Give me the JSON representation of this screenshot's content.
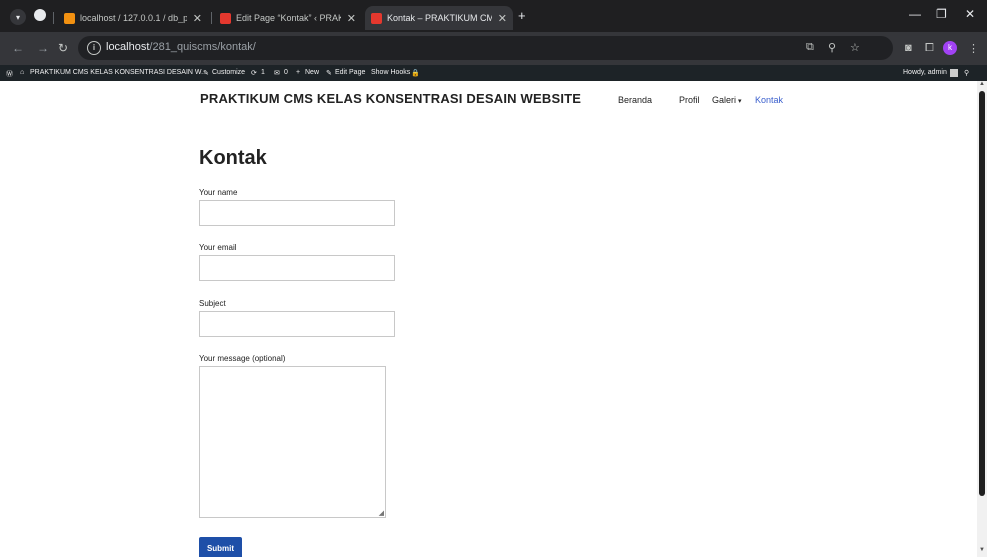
{
  "browser": {
    "tabs": [
      {
        "title": "localhost / 127.0.0.1 / db_prakti",
        "active": false,
        "favicon_color": "#f29111"
      },
      {
        "title": "Edit Page “Kontak” ‹ PRAKTIKUI",
        "active": false,
        "favicon_color": "#e5382e"
      },
      {
        "title": "Kontak – PRAKTIKUM CMS KEL",
        "active": true,
        "favicon_color": "#e5382e"
      }
    ],
    "new_tab": "+",
    "url_host": "localhost",
    "url_path": "/281_quiscms/kontak/",
    "profile_initial": "k"
  },
  "admin_bar": {
    "site_name": "PRAKTIKUM CMS KELAS KONSENTRASI DESAIN W...",
    "customize": "Customize",
    "updates_count": "1",
    "comments_count": "0",
    "new": "New",
    "edit_page": "Edit Page",
    "show_hooks": "Show Hooks",
    "howdy": "Howdy, admin"
  },
  "site": {
    "title": "PRAKTIKUM CMS KELAS KONSENTRASI DESAIN WEBSITE",
    "menu": [
      "Beranda",
      "Profil",
      "Galeri",
      "Kontak"
    ],
    "current_menu": "Kontak",
    "accent": "#3a5fcd"
  },
  "page": {
    "heading": "Kontak",
    "form": {
      "name_label": "Your name",
      "email_label": "Your email",
      "subject_label": "Subject",
      "message_label": "Your message (optional)",
      "submit_label": "Submit",
      "submit_color": "#1e4fa8"
    }
  }
}
